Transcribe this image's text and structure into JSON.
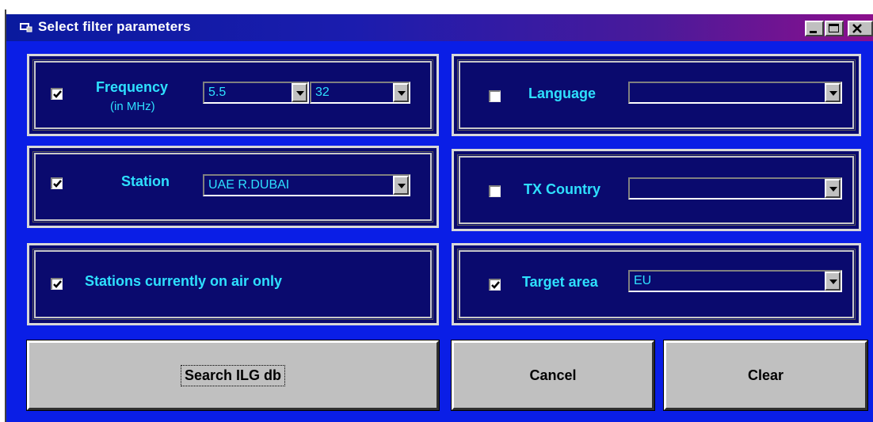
{
  "window": {
    "title": "Select filter parameters",
    "icons": {
      "app": "window-app-icon",
      "minimize": "minimize-icon",
      "maximize": "maximize-icon",
      "close": "close-icon"
    },
    "colors": {
      "client_bg": "#0a1ee6",
      "panel_bg": "#0a0a6e",
      "label": "#2ee0ff"
    }
  },
  "frequency": {
    "checked": true,
    "label": "Frequency",
    "sublabel": "(in MHz)",
    "from_value": "5.5",
    "to_value": "32"
  },
  "station": {
    "checked": true,
    "label": "Station",
    "value": "UAE R.DUBAI"
  },
  "on_air": {
    "checked": true,
    "label": "Stations currently on air only"
  },
  "language": {
    "checked": false,
    "label": "Language",
    "value": ""
  },
  "tx_country": {
    "checked": false,
    "label": "TX Country",
    "value": ""
  },
  "target_area": {
    "checked": true,
    "label": "Target area",
    "value": "EU"
  },
  "buttons": {
    "search": "Search ILG db",
    "cancel": "Cancel",
    "clear": "Clear"
  }
}
